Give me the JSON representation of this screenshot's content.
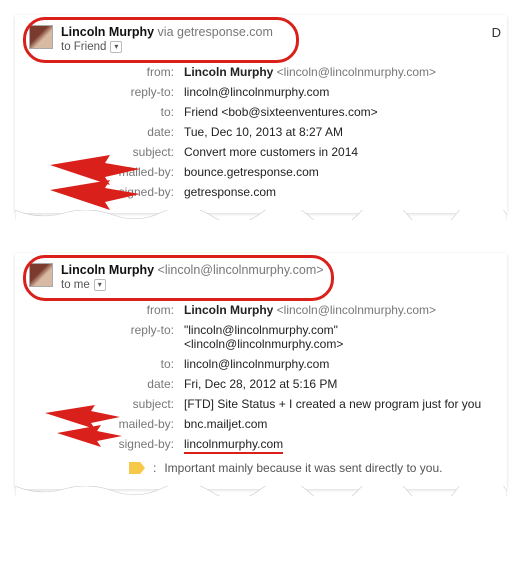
{
  "email1": {
    "sender_name": "Lincoln Murphy",
    "via_label": "via",
    "via_domain": "getresponse.com",
    "to_line_label": "to Friend",
    "side_letter": "D",
    "details": {
      "from_label": "from:",
      "from_value_name": "Lincoln Murphy",
      "from_value_email": "<lincoln@lincolnmurphy.com>",
      "reply_label": "reply-to:",
      "reply_value": "lincoln@lincolnmurphy.com",
      "to_label": "to:",
      "to_value": "Friend <bob@sixteenventures.com>",
      "date_label": "date:",
      "date_value": "Tue, Dec 10, 2013 at 8:27 AM",
      "subject_label": "subject:",
      "subject_value": "Convert more customers in 2014",
      "mailed_label": "mailed-by:",
      "mailed_value": "bounce.getresponse.com",
      "signed_label": "signed-by:",
      "signed_value": "getresponse.com"
    }
  },
  "email2": {
    "sender_name": "Lincoln Murphy",
    "sender_email": "<lincoln@lincolnmurphy.com>",
    "to_line_label": "to me",
    "details": {
      "from_label": "from:",
      "from_value_name": "Lincoln Murphy",
      "from_value_email": "<lincoln@lincolnmurphy.com>",
      "reply_label": "reply-to:",
      "reply_value": "\"lincoln@lincolnmurphy.com\" <lincoln@lincolnmurphy.com>",
      "to_label": "to:",
      "to_value": "lincoln@lincolnmurphy.com",
      "date_label": "date:",
      "date_value": "Fri, Dec 28, 2012 at 5:16 PM",
      "subject_label": "subject:",
      "subject_value": "[FTD] Site Status + I created a new program just for you",
      "mailed_label": "mailed-by:",
      "mailed_value": "bnc.mailjet.com",
      "signed_label": "signed-by:",
      "signed_value": "lincolnmurphy.com",
      "important_text": "Important mainly because it was sent directly to you."
    }
  }
}
